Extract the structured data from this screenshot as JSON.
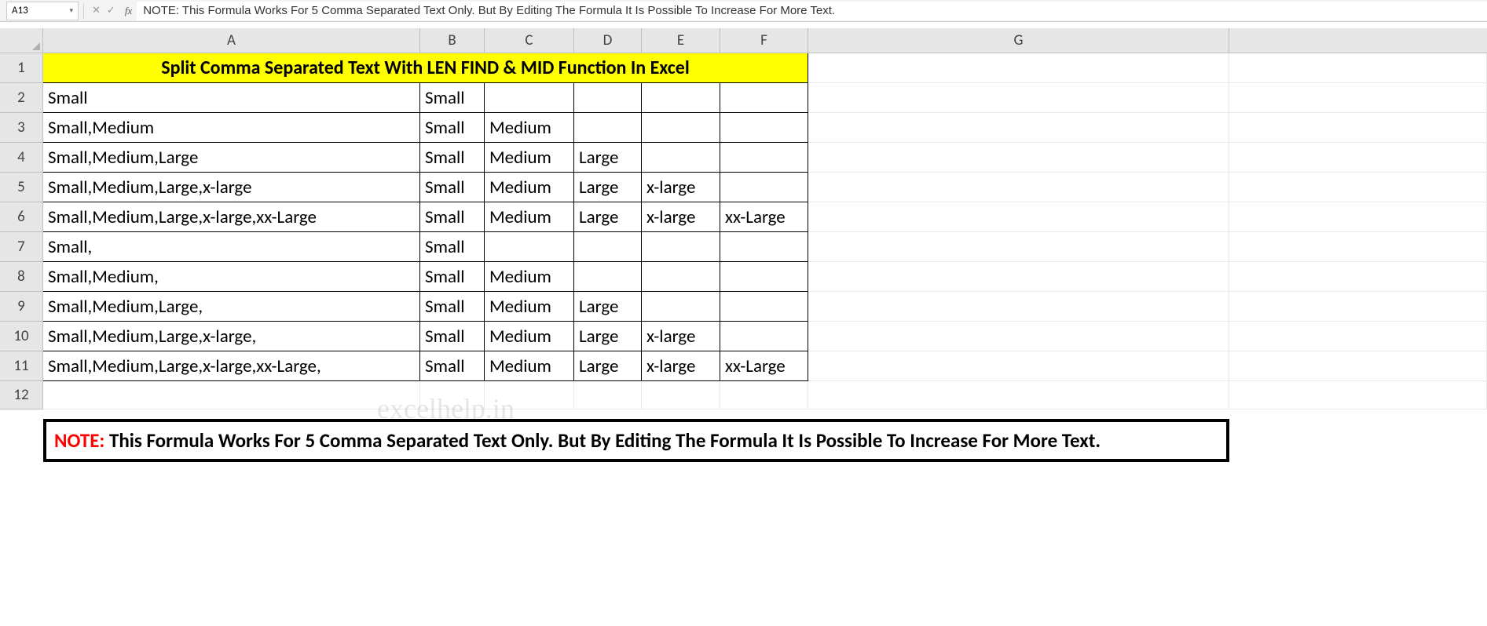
{
  "formula_bar": {
    "cell_ref": "A13",
    "formula_text": "NOTE: This Formula Works For 5 Comma Separated Text Only. But By Editing The Formula It Is Possible To Increase For More Text."
  },
  "columns": [
    "A",
    "B",
    "C",
    "D",
    "E",
    "F",
    "G"
  ],
  "row_numbers": [
    "1",
    "2",
    "3",
    "4",
    "5",
    "6",
    "7",
    "8",
    "9",
    "10",
    "11",
    "12"
  ],
  "title": "Split Comma Separated Text With LEN FIND & MID Function In Excel",
  "rows": [
    {
      "a": "Small",
      "b": "Small",
      "c": "",
      "d": "",
      "e": "",
      "f": ""
    },
    {
      "a": "Small,Medium",
      "b": "Small",
      "c": "Medium",
      "d": "",
      "e": "",
      "f": ""
    },
    {
      "a": "Small,Medium,Large",
      "b": "Small",
      "c": "Medium",
      "d": "Large",
      "e": "",
      "f": ""
    },
    {
      "a": "Small,Medium,Large,x-large",
      "b": "Small",
      "c": "Medium",
      "d": "Large",
      "e": "x-large",
      "f": ""
    },
    {
      "a": "Small,Medium,Large,x-large,xx-Large",
      "b": "Small",
      "c": "Medium",
      "d": "Large",
      "e": "x-large",
      "f": "xx-Large"
    },
    {
      "a": "Small,",
      "b": "Small",
      "c": "",
      "d": "",
      "e": "",
      "f": ""
    },
    {
      "a": "Small,Medium,",
      "b": "Small",
      "c": "Medium",
      "d": "",
      "e": "",
      "f": ""
    },
    {
      "a": "Small,Medium,Large,",
      "b": "Small",
      "c": "Medium",
      "d": "Large",
      "e": "",
      "f": ""
    },
    {
      "a": "Small,Medium,Large,x-large,",
      "b": "Small",
      "c": "Medium",
      "d": "Large",
      "e": "x-large",
      "f": ""
    },
    {
      "a": "Small,Medium,Large,x-large,xx-Large,",
      "b": "Small",
      "c": "Medium",
      "d": "Large",
      "e": "x-large",
      "f": "xx-Large"
    }
  ],
  "watermark": "excelhelp.in",
  "note": {
    "prefix": "NOTE: ",
    "text": "This Formula Works For 5 Comma Separated Text Only. But By Editing The Formula It Is Possible To Increase For More Text."
  }
}
